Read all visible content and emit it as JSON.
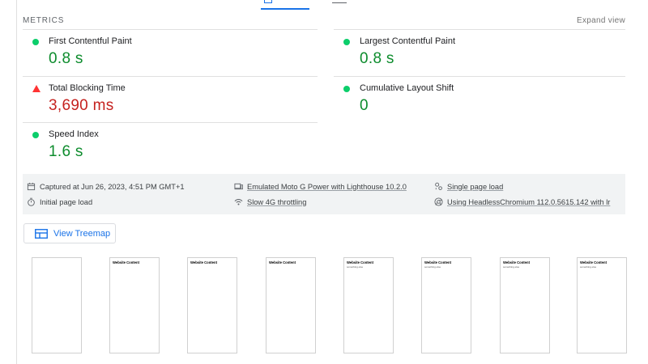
{
  "metrics": {
    "title": "METRICS",
    "expand_label": "Expand view",
    "items": [
      {
        "label": "First Contentful Paint",
        "value": "0.8 s",
        "status": "good"
      },
      {
        "label": "Largest Contentful Paint",
        "value": "0.8 s",
        "status": "good"
      },
      {
        "label": "Total Blocking Time",
        "value": "3,690 ms",
        "status": "bad"
      },
      {
        "label": "Cumulative Layout Shift",
        "value": "0",
        "status": "good"
      },
      {
        "label": "Speed Index",
        "value": "1.6 s",
        "status": "good"
      }
    ]
  },
  "runtime": {
    "captured": "Captured at Jun 26, 2023, 4:51 PM GMT+1",
    "device": "Emulated Moto G Power with Lighthouse 10.2.0",
    "page_load": "Single page load",
    "initial_load": "Initial page load",
    "throttling": "Slow 4G throttling",
    "browser": "Using HeadlessChromium 112.0.5615.142 with lr"
  },
  "treemap_button": {
    "label": "View Treemap"
  },
  "filmstrip": {
    "frames": [
      {
        "title": "",
        "subtitle": ""
      },
      {
        "title": "Website Content",
        "subtitle": ""
      },
      {
        "title": "Website Content",
        "subtitle": ""
      },
      {
        "title": "Website Content",
        "subtitle": ""
      },
      {
        "title": "Website Content",
        "subtitle": "something else"
      },
      {
        "title": "Website Content",
        "subtitle": "something else"
      },
      {
        "title": "Website Content",
        "subtitle": "something else"
      },
      {
        "title": "Website Content",
        "subtitle": "something else"
      }
    ]
  },
  "colors": {
    "good": "#0d8c2d",
    "good_dot": "#0cce6b",
    "bad": "#c5221f",
    "bad_icon": "#ff3333",
    "accent": "#1a73e8",
    "panel": "#f1f3f4"
  },
  "icons": [
    "calendar-icon",
    "device-icon",
    "page-load-icon",
    "stopwatch-icon",
    "network-icon",
    "chromium-icon",
    "treemap-icon"
  ]
}
